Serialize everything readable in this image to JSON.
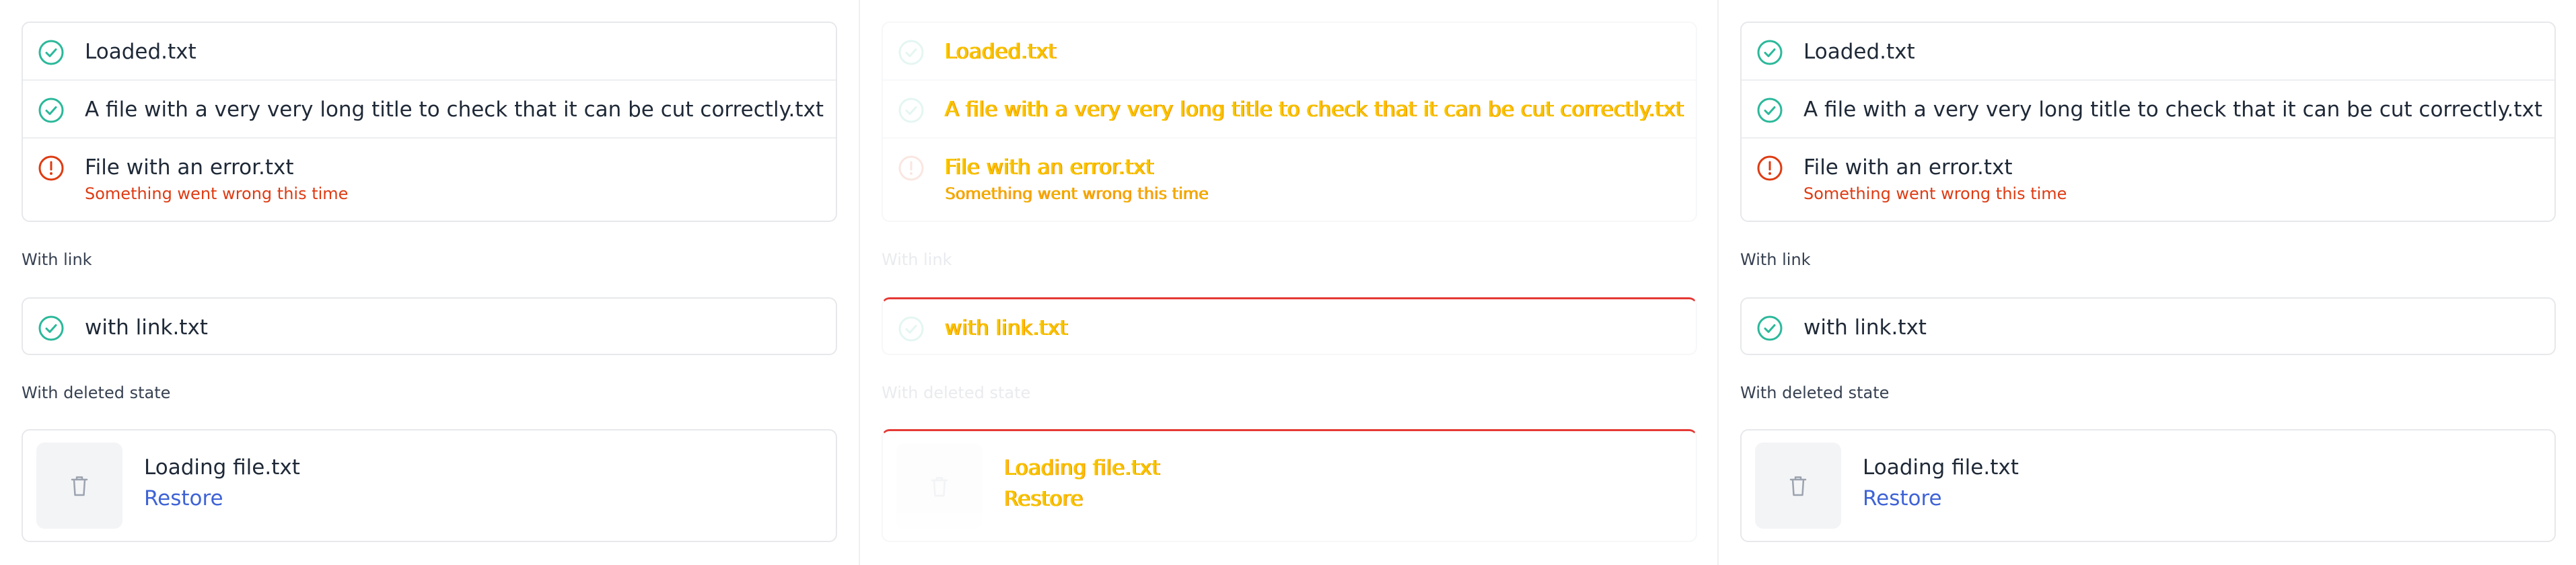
{
  "files": {
    "loaded": "Loaded.txt",
    "long_title": "A file with a very very long title to check that it can be cut correctly.txt",
    "error_file": "File with an error.txt",
    "error_message": "Something went wrong this time"
  },
  "with_link": {
    "label": "With link",
    "file": "with link.txt"
  },
  "with_deleted": {
    "label": "With deleted state",
    "file": "Loading file.txt",
    "restore": "Restore"
  },
  "icons": {
    "success": "check-circle-icon",
    "error": "alert-circle-icon",
    "deleted": "trash-icon"
  },
  "colors": {
    "success": "#2bb89a",
    "error": "#de3b12",
    "link": "#3f63d6"
  }
}
